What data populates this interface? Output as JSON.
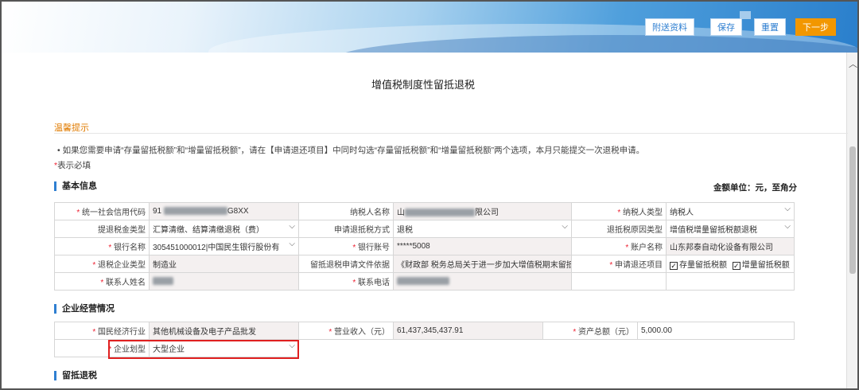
{
  "toolbar": {
    "attach_label": "附送资料",
    "save_label": "保存",
    "reset_label": "重置",
    "next_label": "下一步"
  },
  "page_title": "增值税制度性留抵退税",
  "tips": {
    "title": "温馨提示",
    "text": "• 如果您需要申请“存量留抵税额”和“增量留抵税额”，请在【申请退还项目】中同时勾选“存量留抵税额”和“增量留抵税额”两个选项，本月只能提交一次退税申请。",
    "required_star": "*",
    "required_text": "表示必填"
  },
  "basic": {
    "section_title": "基本信息",
    "unit_note": "金额单位：元，至角分",
    "credit_code_label": "统一社会信用代码",
    "credit_code_prefix": "91",
    "credit_code_suffix": "G8XX",
    "taxpayer_name_label": "纳税人名称",
    "taxpayer_name_prefix": "山",
    "taxpayer_name_suffix": "限公司",
    "taxpayer_type_label": "纳税人类型",
    "taxpayer_type_value": "纳税人",
    "refund_type_label": "提退税金类型",
    "refund_type_value": "汇算清缴、结算清缴退税（费）",
    "deduct_method_label": "申请退抵税方式",
    "deduct_method_value": "退税",
    "reason_type_label": "退抵税原因类型",
    "reason_type_value": "增值税增量留抵税额退税",
    "bank_name_label": "银行名称",
    "bank_name_value": "305451000012|中国民生银行股份有",
    "bank_account_label": "银行账号",
    "bank_account_value": "*****5008",
    "account_name_label": "账户名称",
    "account_name_value": "山东邦泰自动化设备有限公司",
    "enterprise_type_label": "退税企业类型",
    "enterprise_type_value": "制造业",
    "basis_label": "留抵退税申请文件依据",
    "basis_value": "《财政部 税务总局关于进一步加大增值税期末留抵退",
    "refund_item_label": "申请退还项目",
    "refund_item_1": "存量留抵税额",
    "refund_item_2": "增量留抵税额",
    "contact_name_label": "联系人姓名",
    "contact_phone_label": "联系电话"
  },
  "operation": {
    "section_title": "企业经营情况",
    "industry_label": "国民经济行业",
    "industry_value": "其他机械设备及电子产品批发",
    "revenue_label": "营业收入（元）",
    "revenue_value": "61,437,345,437.91",
    "assets_label": "资产总额（元）",
    "assets_value": "5,000.00",
    "scale_label": "企业划型",
    "scale_value": "大型企业"
  },
  "refund": {
    "section_title": "留抵退税"
  },
  "colors": {
    "accent_orange": "#f29700",
    "accent_blue": "#2f7fd1",
    "highlight_red": "#e02020"
  }
}
